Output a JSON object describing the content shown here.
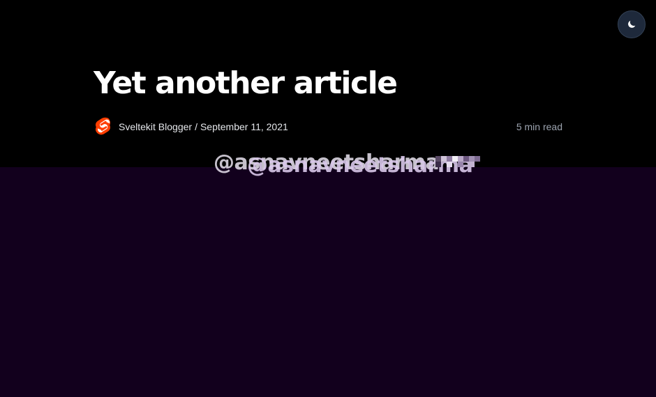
{
  "header": {
    "theme_toggle_icon": "moon-icon",
    "colors": {
      "toggle_bg": "#1e293b",
      "background": "#000000"
    }
  },
  "article": {
    "title": "Yet another article",
    "author_logo_icon": "svelte-logo-icon",
    "author": "Sveltekit Blogger",
    "separator": "/",
    "date": "September 11, 2021",
    "read_time": "5 min read"
  },
  "hero": {
    "handle_back": "@asnavneetsharma",
    "handle_front": "@asnavneetsharma",
    "colors": {
      "background": "#12001d",
      "text": "#e9e3f0"
    }
  }
}
